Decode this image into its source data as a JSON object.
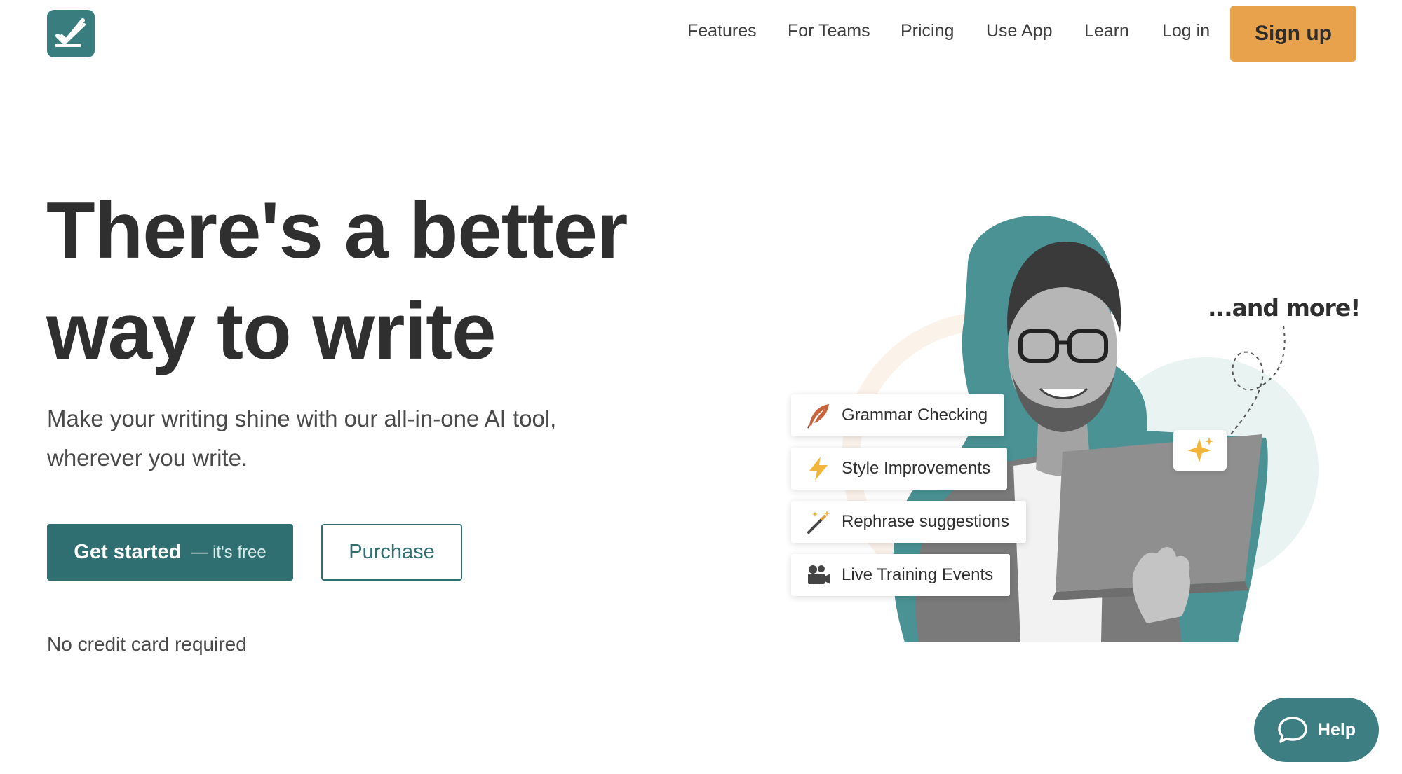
{
  "header": {
    "logo_icon": "checkmark-pen-icon",
    "nav": [
      "Features",
      "For Teams",
      "Pricing",
      "Use App",
      "Learn",
      "Log in"
    ],
    "signup_label": "Sign up"
  },
  "hero": {
    "headline_line1": "There's a better",
    "headline_line2": "way to write",
    "subtitle": "Make your writing shine with our all-in-one AI tool, wherever you write.",
    "cta_primary_main": "Get started",
    "cta_primary_sub": "— it's free",
    "cta_secondary": "Purchase",
    "note": "No credit card required"
  },
  "illustration": {
    "annotation": "...and more!",
    "features": [
      {
        "label": "Grammar Checking",
        "icon": "quill-icon"
      },
      {
        "label": "Style Improvements",
        "icon": "lightning-icon"
      },
      {
        "label": "Rephrase suggestions",
        "icon": "magic-wand-icon"
      },
      {
        "label": "Live Training Events",
        "icon": "video-camera-icon"
      }
    ]
  },
  "help": {
    "label": "Help"
  },
  "colors": {
    "brand": "#3a7d7f",
    "accent": "#e9a24c",
    "primary_button": "#2f6f72"
  }
}
